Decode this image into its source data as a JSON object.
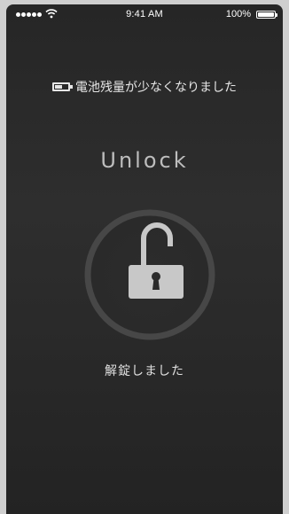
{
  "status_bar": {
    "signal_dots": 5,
    "wifi_icon": "wifi-icon",
    "time": "9:41 AM",
    "battery_percent": "100%",
    "battery_icon": "battery-full-icon"
  },
  "notice": {
    "icon": "low-battery-icon",
    "text": "電池残量が少なくなりました"
  },
  "unlock": {
    "title": "Unlock",
    "icon": "open-padlock-icon",
    "status": "解錠しました"
  },
  "colors": {
    "background": "#2a2a2a",
    "ring": "#474747",
    "lock": "#c8c8c8",
    "text": "#e6e6e6"
  }
}
